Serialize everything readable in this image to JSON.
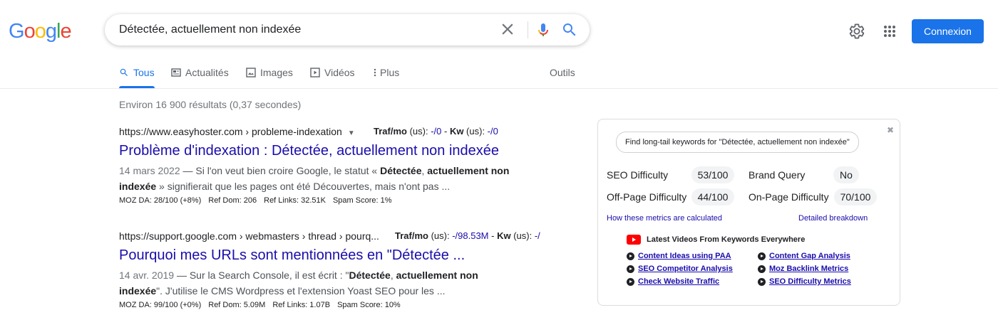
{
  "logo": {
    "letters": [
      "G",
      "o",
      "o",
      "g",
      "l",
      "e"
    ],
    "colors": [
      "#4285f4",
      "#ea4335",
      "#fbbc05",
      "#4285f4",
      "#34a853",
      "#ea4335"
    ]
  },
  "search": {
    "query": "Détectée, actuellement non indexée"
  },
  "header": {
    "connexion_label": "Connexion"
  },
  "tabs": [
    {
      "label": "Tous",
      "icon": "search-icon",
      "active": true
    },
    {
      "label": "Actualités",
      "icon": "news-icon"
    },
    {
      "label": "Images",
      "icon": "image-icon"
    },
    {
      "label": "Vidéos",
      "icon": "video-icon"
    },
    {
      "label": "Plus",
      "icon": "more-vert-icon"
    }
  ],
  "tools_label": "Outils",
  "stats": "Environ 16 900 résultats (0,37 secondes)",
  "results": [
    {
      "cite": "https://www.easyhoster.com › probleme-indexation",
      "traf_label": "Traf/mo",
      "traf_us": " (us): ",
      "traf_value": "-/0",
      "kw_label": "Kw",
      "kw_us": " (us): ",
      "kw_value": "-/0",
      "title": "Problème d'indexation : Détectée, actuellement non indexée",
      "date": "14 mars 2022",
      "snippet_a": " — Si l'on veut bien croire Google, le statut « ",
      "snippet_b1": "Détectée",
      "snippet_c": ", ",
      "snippet_b2": "actuellement non indexée",
      "snippet_d": " » signifierait que les pages ont été Découvertes, mais n'ont pas ...",
      "moz": [
        "MOZ DA: 28/100 (+8%)",
        "Ref Dom: 206",
        "Ref Links: 32.51K",
        "Spam Score: 1%"
      ]
    },
    {
      "cite": "https://support.google.com › webmasters › thread › pourq...",
      "traf_label": "Traf/mo",
      "traf_us": " (us): ",
      "traf_value": "-/98.53M",
      "kw_label": "Kw",
      "kw_us": " (us): ",
      "kw_value": "-/",
      "title": "Pourquoi mes URLs sont mentionnées en \"Détectée ...",
      "date": "14 avr. 2019",
      "snippet_a": " — Sur la Search Console, il est écrit : \"",
      "snippet_b1": "Détectée",
      "snippet_c": ", ",
      "snippet_b2": "actuellement non indexée",
      "snippet_d": "\". J'utilise le CMS Wordpress et l'extension Yoast SEO pour les ...",
      "moz": [
        "MOZ DA: 99/100 (+0%)",
        "Ref Dom: 5.09M",
        "Ref Links: 1.07B",
        "Spam Score: 10%"
      ]
    }
  ],
  "kw_panel": {
    "find_label": "Find long-tail keywords for \"Détectée, actuellement non indexée\"",
    "seo_difficulty_label": "SEO Difficulty",
    "seo_difficulty_value": "53/100",
    "brand_query_label": "Brand Query",
    "brand_query_value": "No",
    "offpage_label": "Off-Page Difficulty",
    "offpage_value": "44/100",
    "onpage_label": "On-Page Difficulty",
    "onpage_value": "70/100",
    "how_link": "How these metrics are calculated",
    "detailed_link": "Detailed breakdown",
    "videos_heading": "Latest Videos From Keywords Everywhere",
    "videos": [
      "Content Ideas using PAA",
      "Content Gap Analysis",
      "SEO Competitor Analysis",
      "Moz Backlink Metrics",
      "Check Website Traffic",
      "SEO Difficulty Metrics"
    ]
  }
}
